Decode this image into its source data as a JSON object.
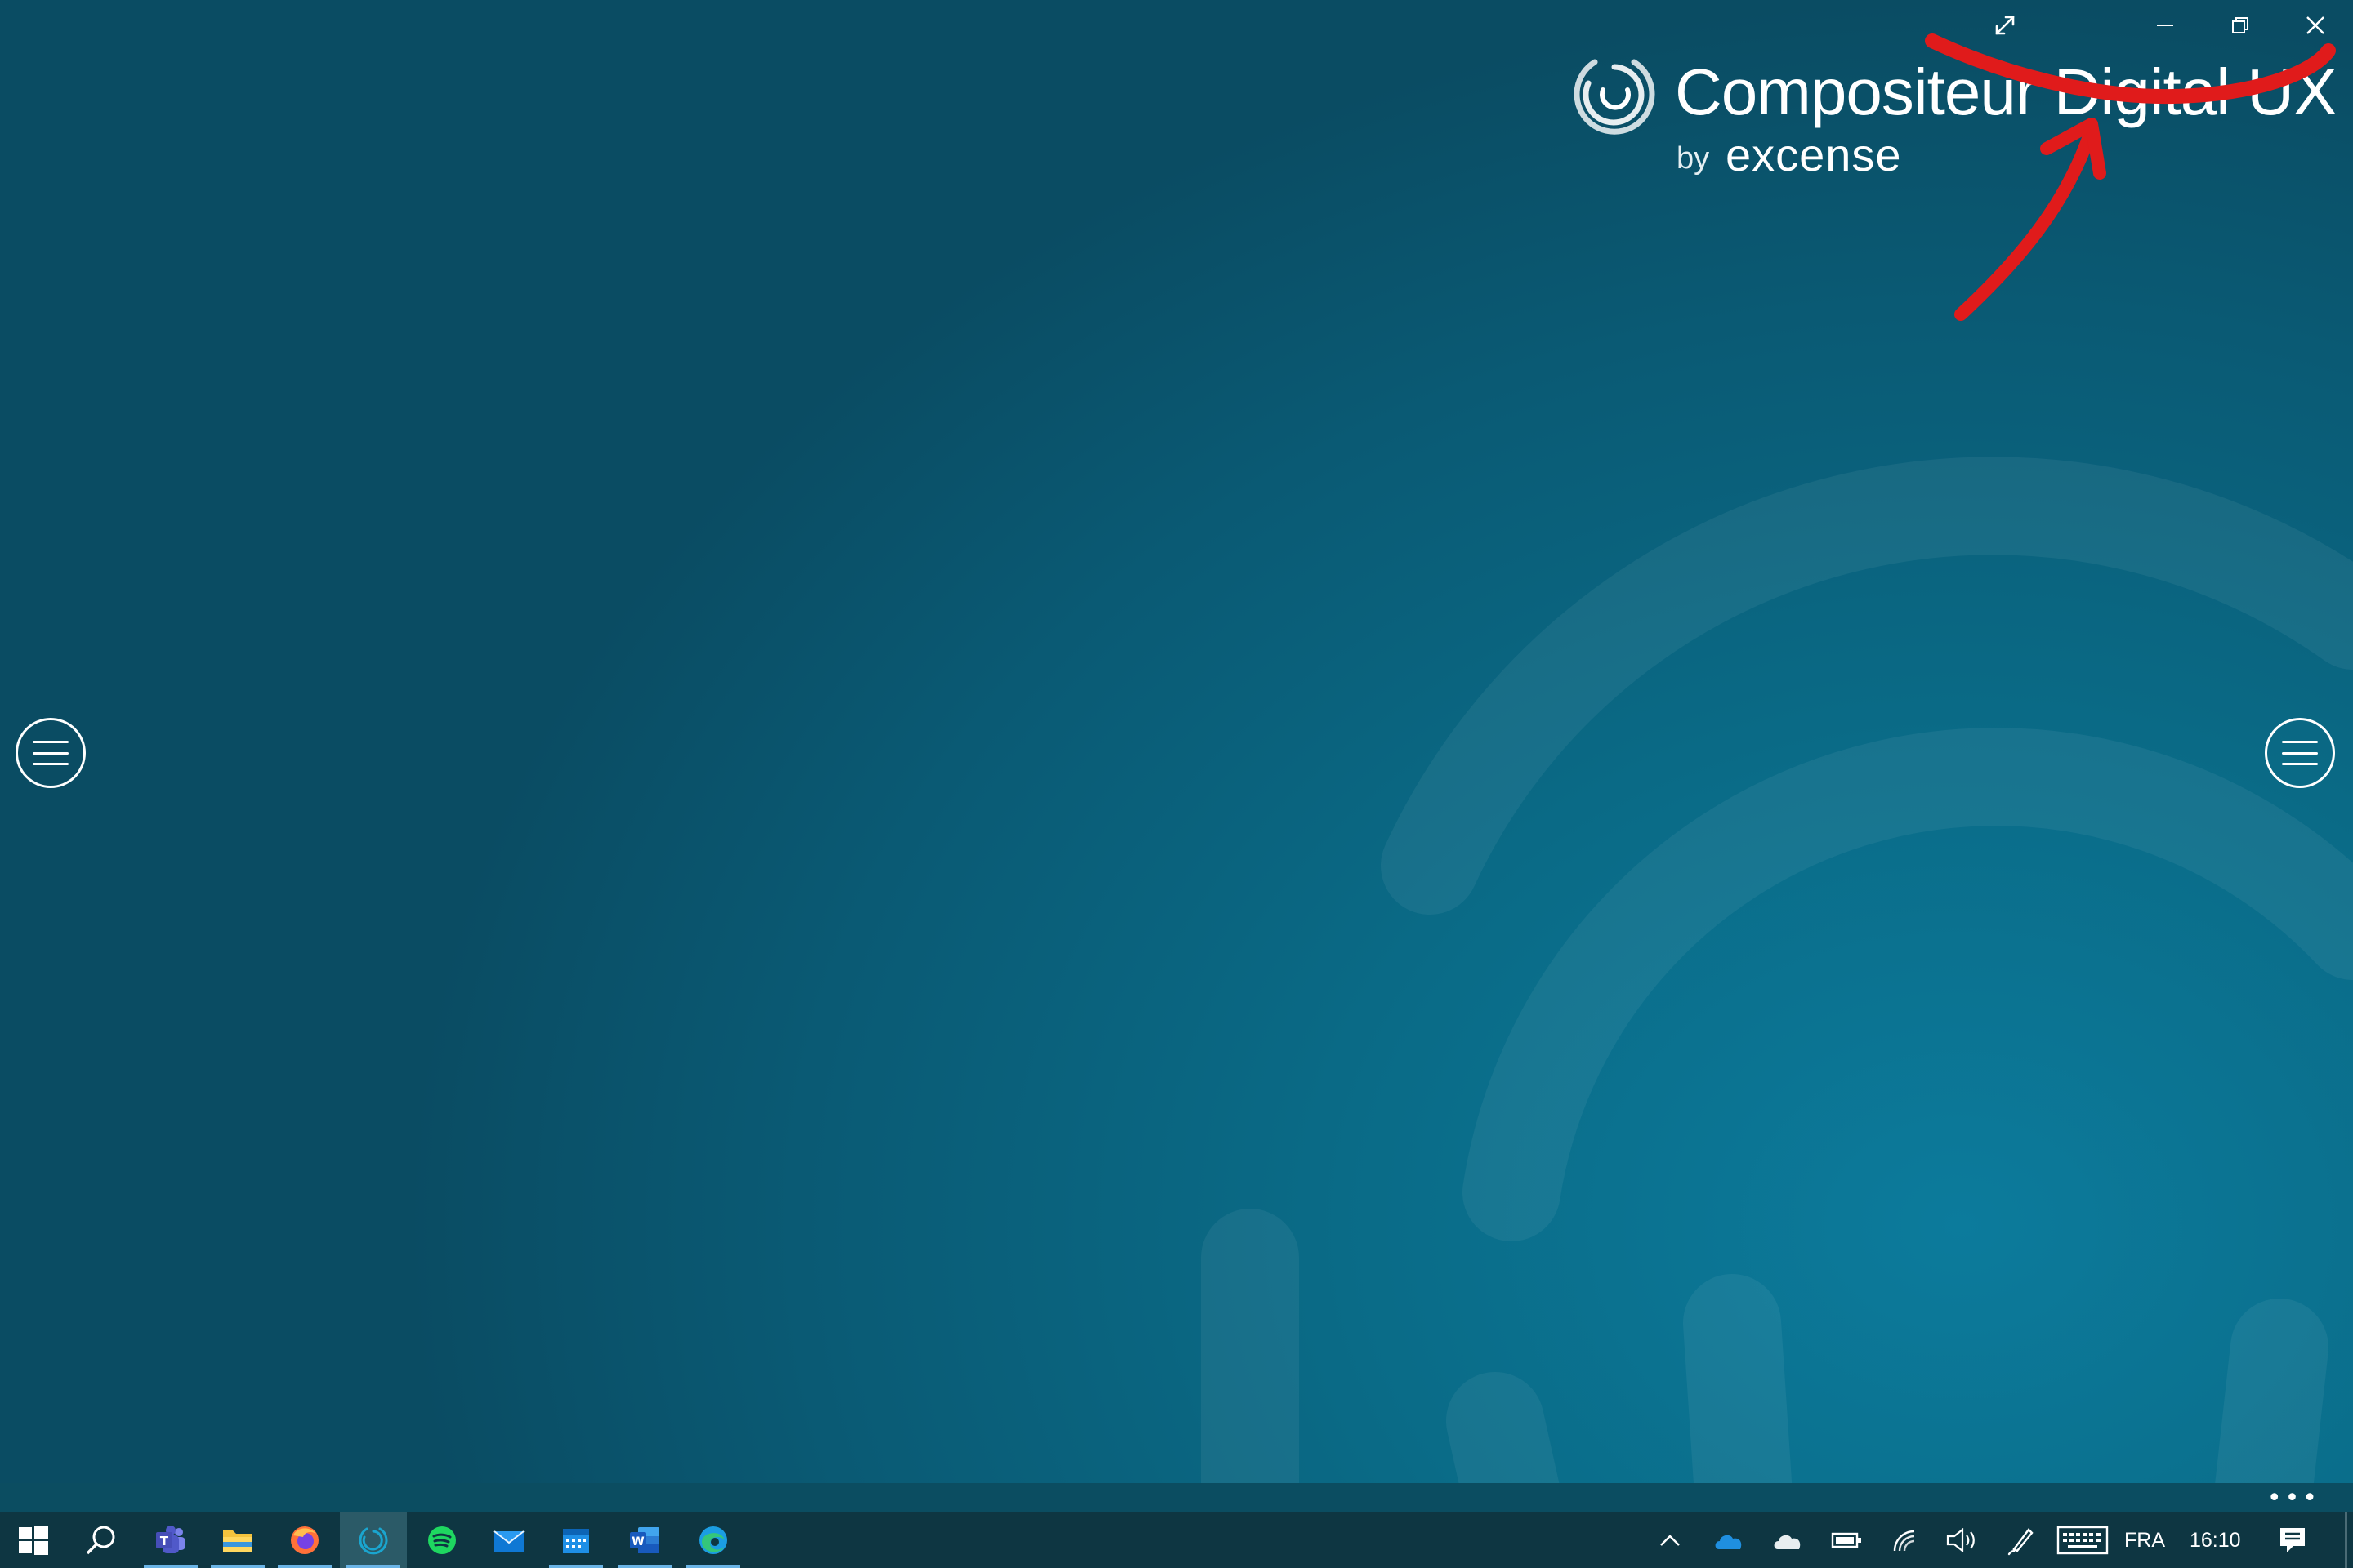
{
  "app": {
    "title": "Compositeur Digital UX",
    "by": "by",
    "brand": "excense"
  },
  "window_controls": [
    "fullscreen-toggle",
    "minimize",
    "restore",
    "close"
  ],
  "side_menus": [
    "left-menu",
    "right-menu"
  ],
  "taskbar": {
    "pinned_apps": [
      "windows-start",
      "search",
      "teams",
      "file-explorer",
      "firefox",
      "compositeur-digital",
      "spotify",
      "mail",
      "calendar",
      "word",
      "edge"
    ],
    "active_app": "compositeur-digital",
    "tray_icons": [
      "show-hidden-icons",
      "onedrive-blue",
      "onedrive-white",
      "battery",
      "wifi",
      "volume",
      "pen",
      "touch-keyboard",
      "notifications"
    ],
    "language": "FRA",
    "time": "16:10",
    "more": "•••"
  },
  "colors": {
    "background_dark": "#0a4c63",
    "background_light": "#0c7b9c",
    "taskbar": "#0e3642",
    "annotation": "#e01b1b",
    "accent_underline": "#6ab4e6"
  }
}
